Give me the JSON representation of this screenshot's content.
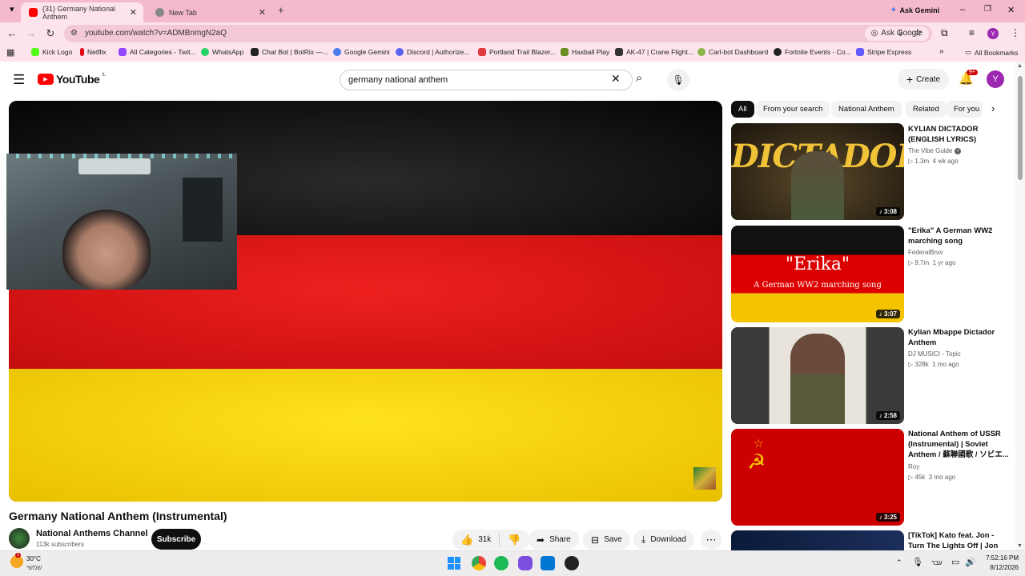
{
  "browser": {
    "tabs": [
      {
        "label": "(31) Germany National Anthem"
      },
      {
        "label": "New Tab"
      }
    ],
    "ask_gemini": "Ask Gemini",
    "url": "youtube.com/watch?v=ADMBnmgN2aQ",
    "ask_google": "Ask Google",
    "profile_initial": "Y",
    "bookmarks": [
      "Kick Logo",
      "Netflix",
      "All Categories - Twit...",
      "WhatsApp",
      "Chat Bot | BotRix —...",
      "Google Gemini",
      "Discord | Authorize...",
      "Portland Trail Blazer...",
      "Haxball Play",
      "AK-47 | Crane Flight...",
      "Carl-bot Dashboard",
      "Fortnite Events - Co...",
      "Stripe Express"
    ],
    "all_bookmarks": "All Bookmarks",
    "accent": "#f5b9cc"
  },
  "youtube": {
    "logo": "YouTube",
    "region": "IL",
    "search_query": "germany national anthem",
    "create": "Create",
    "notif_count": "9+",
    "avatar": "Y"
  },
  "video": {
    "title": "Germany National Anthem (Instrumental)",
    "channel": "National Anthems Channel",
    "subscribers": "113k subscribers",
    "subscribe": "Subscribe",
    "likes": "31k",
    "share": "Share",
    "save": "Save",
    "download": "Download"
  },
  "chips": [
    "All",
    "From your search",
    "National Anthem",
    "Related",
    "For you"
  ],
  "recommendations": [
    {
      "title": "KYLIAN DICTADOR (ENGLISH LYRICS)",
      "channel": "The Vibe Guide",
      "views": "1.3m",
      "age": "4 wk ago",
      "duration": "3:08",
      "thumb_text": "DICTADOR"
    },
    {
      "title": "\"Erika\" A German WW2 marching song",
      "channel": "FederalBruv",
      "views": "9.7m",
      "age": "1 yr ago",
      "duration": "3:07",
      "thumb_text": "\"Erika\"",
      "thumb_sub": "A German WW2 marching song"
    },
    {
      "title": "Kylian Mbappe Dictador Anthem",
      "channel": "DJ MUSICI - Topic",
      "views": "328k",
      "age": "1 mo ago",
      "duration": "2:58"
    },
    {
      "title": "National Anthem of USSR (Instrumental) | Soviet Anthem / 蘇聯國歌 / ソビエ...",
      "channel": "Roy",
      "views": "45k",
      "age": "3 mo ago",
      "duration": "3:25"
    },
    {
      "title": "[TikTok] Kato feat. Jon - Turn The Lights Off | Jon Hamm",
      "channel": "",
      "views": "",
      "age": "",
      "duration": ""
    }
  ],
  "taskbar": {
    "temp": "30°C",
    "weather_label": "שמשי",
    "weather_badge": "1",
    "lang": "עבר",
    "time": "7:52:16 PM",
    "date": "8/12/2026"
  }
}
